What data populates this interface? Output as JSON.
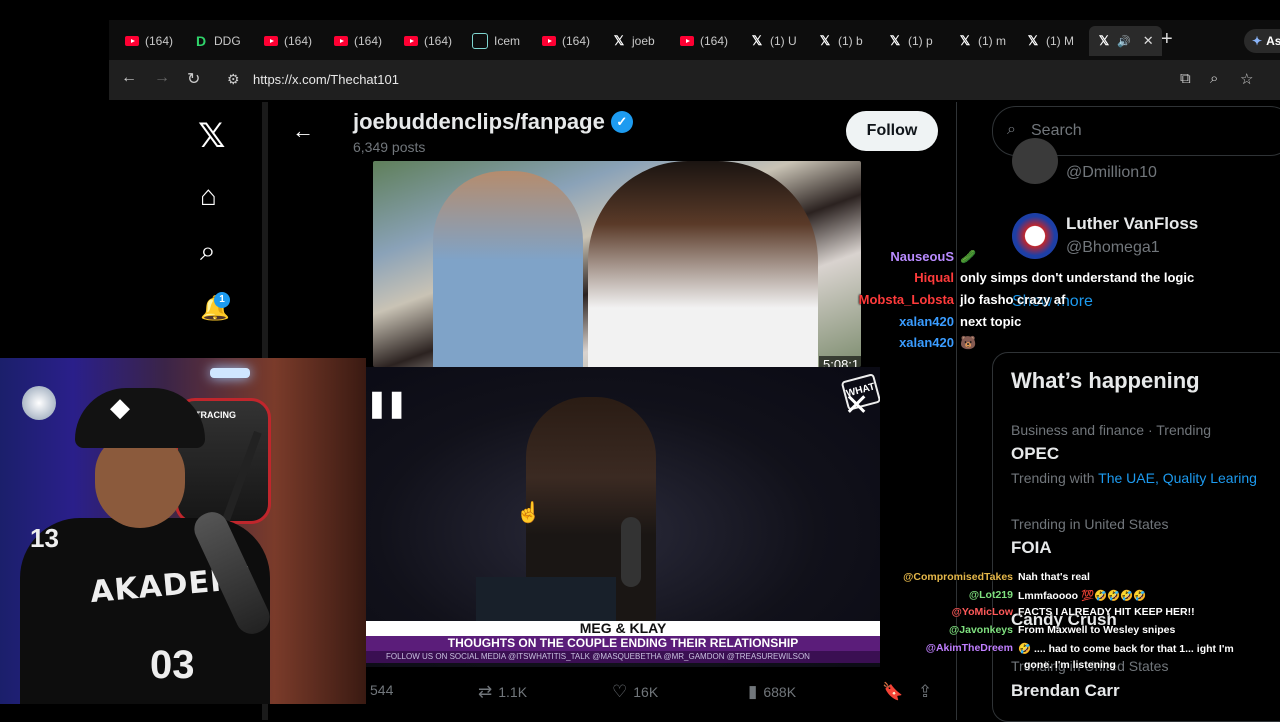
{
  "browser": {
    "tabs": [
      {
        "icon": "youtube",
        "label": "(164)"
      },
      {
        "icon": "ddg",
        "label": "DDG"
      },
      {
        "icon": "youtube",
        "label": "(164)"
      },
      {
        "icon": "youtube",
        "label": "(164)"
      },
      {
        "icon": "youtube",
        "label": "(164)"
      },
      {
        "icon": "ice",
        "label": "Icem"
      },
      {
        "icon": "youtube",
        "label": "(164)"
      },
      {
        "icon": "x",
        "label": "joeb"
      },
      {
        "icon": "youtube",
        "label": "(164)"
      },
      {
        "icon": "x",
        "label": "(1) U"
      },
      {
        "icon": "x",
        "label": "(1) b"
      },
      {
        "icon": "x",
        "label": "(1) p"
      },
      {
        "icon": "x",
        "label": "(1) m"
      },
      {
        "icon": "x",
        "label": "(1) M"
      }
    ],
    "active_tab_icon": "x",
    "ask_label": "Ask",
    "url": "https://x.com/Thechat101"
  },
  "profile": {
    "name": "joebuddenclips/fanpage",
    "posts": "6,349 posts",
    "follow_label": "Follow"
  },
  "video": {
    "timestamp": "5:08:1",
    "lower_third_title": "MEG & KLAY",
    "lower_third_sub": "THOUGHTS ON THE COUPLE ENDING THEIR RELATIONSHIP",
    "ticker": "FOLLOW US ON SOCIAL MEDIA @ITSWHATITIS_TALK @MASQUEBETHA @MR_GAMDON @TREASUREWILSON",
    "logo_text": "WHAT"
  },
  "actions": {
    "replies": "544",
    "reposts": "1.1K",
    "likes": "16K",
    "views": "688K"
  },
  "search": {
    "placeholder": "Search"
  },
  "who_to_follow": [
    {
      "handle": "@Dmillion10"
    },
    {
      "name": "Luther VanFloss",
      "handle": "@Bhomega1"
    }
  ],
  "show_more": "Show more",
  "happening": {
    "title": "What’s happening",
    "trends": [
      {
        "meta": "Business and finance · Trending",
        "name": "OPEC",
        "with_prefix": "Trending with",
        "with_links": "The UAE, Quality Learing"
      },
      {
        "meta": "Trending in United States",
        "name": "FOIA"
      },
      {
        "name": "Candy Crush"
      },
      {
        "meta": "Trending in United States",
        "name": "Brendan Carr"
      }
    ]
  },
  "chat_top": [
    {
      "user": "NauseouS",
      "color": "#b98bff",
      "msg": "🥒"
    },
    {
      "user": "Hiqual",
      "color": "#ff3b3b",
      "msg": "only simps don't understand the logic"
    },
    {
      "user": "Mobsta_Lobsta",
      "color": "#ff3b3b",
      "msg": "jlo fasho crazy af"
    },
    {
      "user": "xalan420",
      "color": "#3a9cff",
      "msg": "next topic"
    },
    {
      "user": "xalan420",
      "color": "#3a9cff",
      "msg": "🐻"
    }
  ],
  "chat_bottom": [
    {
      "user": "@CompromisedTakes",
      "color": "#e6b84a",
      "msg": "Nah that's real"
    },
    {
      "user": "@Lot219",
      "color": "#7fe07f",
      "msg": "Lmmfaoooo 💯🤣🤣🤣🤣"
    },
    {
      "user": "@YoMicLow",
      "color": "#ff5a5a",
      "msg": "FACTS I ALREADY HIT KEEP HER!!"
    },
    {
      "user": "@Javonkeys",
      "color": "#7fe07f",
      "msg": "From Maxwell to Wesley snipes"
    },
    {
      "user": "@AkimTheDreem",
      "color": "#c07fff",
      "msg": "🤣 .... had to come back for that 1... ight I'm"
    },
    {
      "user": "",
      "color": "#ffffff",
      "msg": "gone. I'm listening"
    }
  ],
  "webcam": {
    "jersey_text": "AKADEMI",
    "jersey_number": "03",
    "sleeve_number": "13",
    "chair_label": "TRACING"
  },
  "notifications_count": "1"
}
